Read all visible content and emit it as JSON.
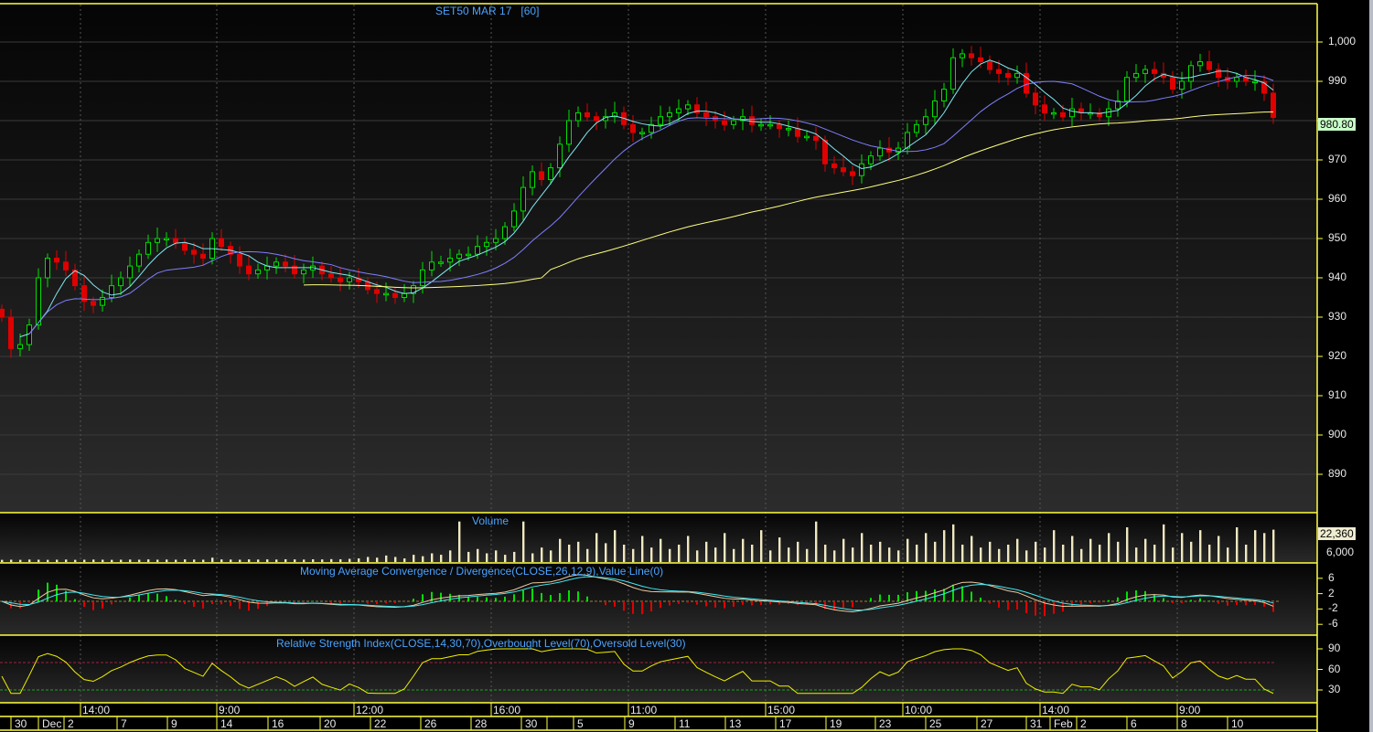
{
  "title": "SET50 MAR 17",
  "interval": "[60]",
  "price_axis": {
    "ticks": [
      "1,000",
      "990",
      "980",
      "970",
      "960",
      "950",
      "940",
      "930",
      "920",
      "910",
      "900",
      "890"
    ],
    "last_price": "980.80",
    "last_price_color": "#c8ffc8"
  },
  "volume_panel": {
    "label": "Volume",
    "ticks": [
      "6,000"
    ],
    "last_volume": "22,360",
    "last_volume_color": "#f0ecd0"
  },
  "macd_panel": {
    "label": "Moving Average Convergence / Divergence(CLOSE,26,12,9),Value Line(0)",
    "ticks": [
      "6",
      "2",
      "-2",
      "-6"
    ]
  },
  "rsi_panel": {
    "label": "Relative Strength Index(CLOSE,14,30,70),Overbought Level(70),Oversold Level(30)",
    "ticks": [
      "90",
      "60",
      "30"
    ]
  },
  "time_axis": {
    "hours": [
      "14:00",
      "9:00",
      "12:00",
      "16:00",
      "11:00",
      "15:00",
      "10:00",
      "14:00",
      "9:00"
    ],
    "days": [
      "30",
      "Dec",
      "2",
      "7",
      "9",
      "14",
      "16",
      "20",
      "22",
      "26",
      "28",
      "30",
      "",
      "5",
      "9",
      "11",
      "13",
      "17",
      "19",
      "23",
      "25",
      "27",
      "31",
      "Feb",
      "2",
      "6",
      "8",
      "10"
    ]
  },
  "colors": {
    "up": "#00e000",
    "down": "#e00000",
    "ma_fast": "#7fe8f0",
    "ma_mid": "#7f7fff",
    "ma_slow": "#ffff80",
    "volume": "#f0e8c0",
    "axis": "#ffff40"
  },
  "chart_data": {
    "type": "candlestick",
    "title": "SET50 MAR 17 [60]",
    "ylim": [
      880,
      1005
    ],
    "close": [
      930,
      922,
      923,
      928,
      940,
      945,
      944,
      942,
      938,
      934,
      933,
      935,
      938,
      940,
      943,
      946,
      949,
      950,
      950,
      949,
      947,
      946,
      945,
      950,
      948,
      946,
      943,
      941,
      942,
      943,
      944,
      943,
      941,
      942,
      943,
      941,
      940,
      939,
      940,
      939,
      937,
      936,
      936,
      935,
      936,
      938,
      942,
      944,
      944,
      945,
      946,
      946,
      948,
      949,
      950,
      953,
      957,
      963,
      967,
      965,
      968,
      974,
      980,
      982,
      981,
      980,
      981,
      982,
      979,
      977,
      977,
      979,
      981,
      982,
      983,
      984,
      982,
      981,
      980,
      979,
      980,
      981,
      979,
      979,
      979,
      978,
      978,
      976,
      976,
      975,
      969,
      968,
      967,
      966,
      969,
      971,
      973,
      972,
      973,
      977,
      979,
      981,
      985,
      988,
      996,
      997,
      996,
      995,
      993,
      992,
      991,
      992,
      987,
      984,
      982,
      982,
      981,
      983,
      982,
      982,
      981,
      983,
      985,
      991,
      992,
      993,
      992,
      991,
      988,
      990,
      994,
      995,
      993,
      991,
      990,
      991,
      990,
      990,
      987,
      980.8
    ],
    "volume": [
      1500,
      1600,
      1500,
      1700,
      1600,
      1500,
      1600,
      1700,
      1500,
      1600,
      1700,
      1600,
      1500,
      1600,
      1700,
      1600,
      1800,
      1600,
      1700,
      1600,
      1800,
      1700,
      1600,
      3000,
      1800,
      1700,
      1600,
      1800,
      1700,
      1800,
      1700,
      1900,
      1800,
      1700,
      1900,
      1800,
      2000,
      1900,
      2200,
      2500,
      3500,
      3000,
      4500,
      3500,
      2500,
      5000,
      4000,
      6000,
      5000,
      8000,
      28000,
      7000,
      9000,
      6000,
      8000,
      5000,
      7000,
      28000,
      6000,
      10000,
      8000,
      16000,
      12000,
      14000,
      9000,
      20000,
      13000,
      22000,
      12000,
      9000,
      18000,
      10000,
      16000,
      9000,
      12000,
      18000,
      8000,
      14000,
      10000,
      20000,
      9000,
      16000,
      12000,
      22000,
      8000,
      17000,
      10000,
      14000,
      9000,
      28000,
      12000,
      8000,
      16000,
      10000,
      20000,
      12000,
      14000,
      10000,
      8000,
      16000,
      12000,
      20000,
      14000,
      22000,
      26000,
      12000,
      18000,
      10000,
      14000,
      9000,
      12000,
      16000,
      8000,
      14000,
      10000,
      22000,
      12000,
      18000,
      9000,
      16000,
      12000,
      20000,
      14000,
      24000,
      10000,
      16000,
      12000,
      26000,
      10000,
      20000,
      14000,
      22000,
      12000,
      18000,
      10000,
      24000,
      12000,
      22000,
      20000,
      22360
    ],
    "ma_periods": [
      5,
      14,
      60
    ]
  }
}
